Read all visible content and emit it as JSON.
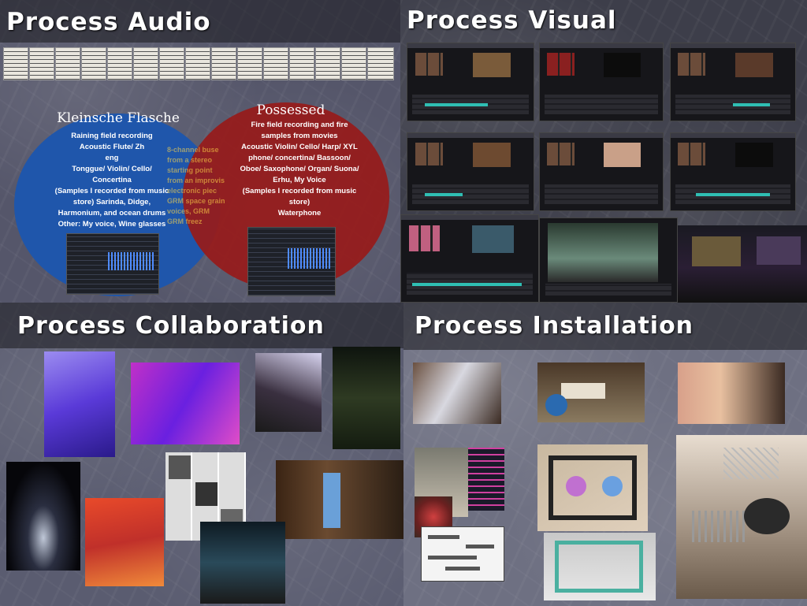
{
  "headings": {
    "audio": "Process Audio",
    "visual": "Process Visual",
    "collaboration": "Process Collaboration",
    "installation": "Process Installation"
  },
  "audio": {
    "left_circle": {
      "title": "Kleinsche Flasche",
      "lines": [
        "Raining field recording",
        "Acoustic Flute/ Zh",
        "eng",
        "Tonggue/ Violin/ Cello/",
        "Concertina",
        "(Samples I recorded from music",
        "store) Sarinda, Didge,",
        "Harmonium, and ocean drums",
        "Other: My voice, Wine glasses"
      ]
    },
    "right_circle": {
      "title": "Possessed",
      "lines": [
        "Fire field recording and fire",
        "samples from movies",
        "Acoustic Violin/ Cello/ Harp/ XYL",
        "phone/ concertina/ Bassoon/",
        "Oboe/ Saxophone/ Organ/ Suona/",
        "Erhu, My Voice",
        "(Samples I recorded from music",
        "store)",
        "Waterphone"
      ]
    },
    "overlap_lines": [
      "8-channel buse",
      "from a stereo",
      "starting point",
      "from an improvis",
      "electronic piec",
      "GRM space grain",
      "voices, GRM",
      "GRM freez"
    ]
  },
  "colors": {
    "left_circle": "#1f56ab",
    "right_circle": "#961c1c",
    "heading": "#ffffff",
    "overlap_text": "#ffd84a"
  }
}
